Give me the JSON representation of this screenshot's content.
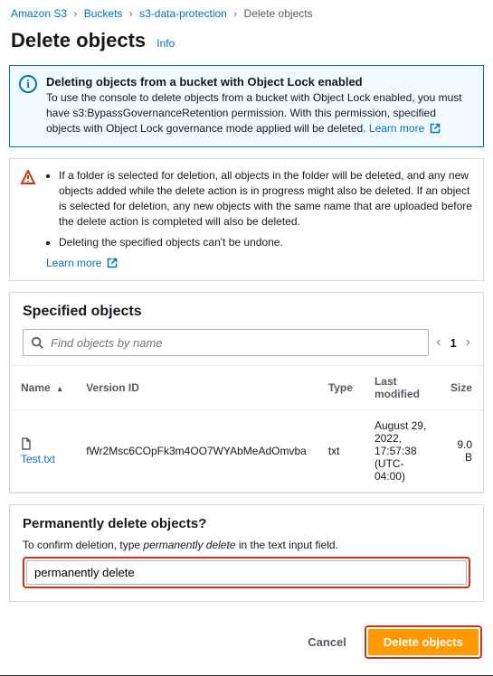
{
  "breadcrumbs": {
    "items": [
      "Amazon S3",
      "Buckets",
      "s3-data-protection"
    ],
    "current": "Delete objects"
  },
  "page": {
    "title": "Delete objects",
    "info_label": "Info"
  },
  "info_box": {
    "title": "Deleting objects from a bucket with Object Lock enabled",
    "body": "To use the console to delete objects from a bucket with Object Lock enabled, you must have s3:BypassGovernanceRetention permission. With this permission, specified objects with Object Lock governance mode applied will be deleted.",
    "learn_more": "Learn more"
  },
  "warn_box": {
    "bullets": [
      "If a folder is selected for deletion, all objects in the folder will be deleted, and any new objects added while the delete action is in progress might also be deleted. If an object is selected for deletion, any new objects with the same name that are uploaded before the delete action is completed will also be deleted.",
      "Deleting the specified objects can't be undone."
    ],
    "learn_more": "Learn more"
  },
  "specified": {
    "heading": "Specified objects",
    "search_placeholder": "Find objects by name",
    "page": "1",
    "columns": {
      "name": "Name",
      "version": "Version ID",
      "type": "Type",
      "modified": "Last modified",
      "size": "Size"
    },
    "rows": [
      {
        "name": "Test.txt",
        "version": "fWr2Msc6COpFk3m4OO7WYAbMeAdOmvba",
        "type": "txt",
        "modified": "August 29, 2022, 17:57:38 (UTC-04:00)",
        "size": "9.0 B"
      }
    ]
  },
  "confirm": {
    "heading": "Permanently delete objects?",
    "hint_pre": "To confirm deletion, type ",
    "hint_em": "permanently delete",
    "hint_post": " in the text input field.",
    "value": "permanently delete"
  },
  "footer": {
    "cancel": "Cancel",
    "delete": "Delete objects"
  }
}
